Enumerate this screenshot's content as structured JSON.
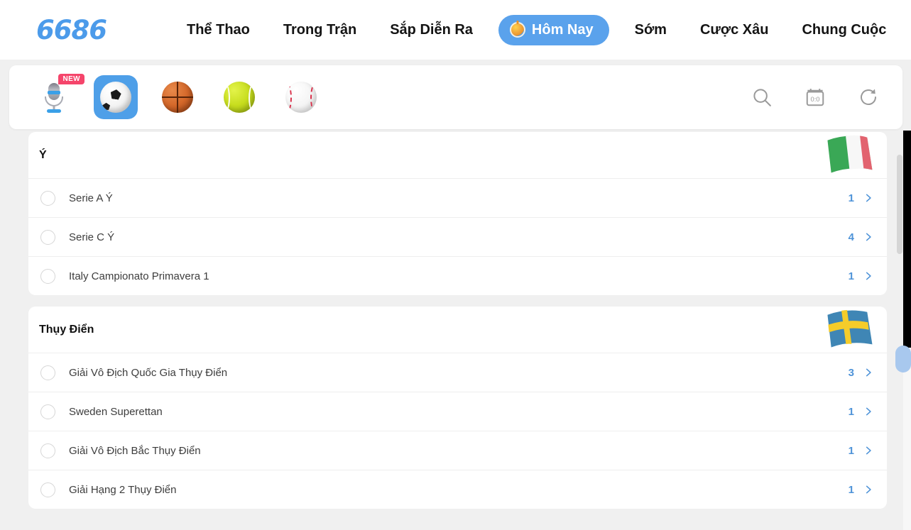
{
  "brand": {
    "logo_text": "6686",
    "logo_color": "#4c9bea"
  },
  "topnav": {
    "items": [
      {
        "label": "Thể Thao",
        "active": false
      },
      {
        "label": "Trong Trận",
        "active": false
      },
      {
        "label": "Sắp Diễn Ra",
        "active": false
      },
      {
        "label": "Hôm Nay",
        "active": true,
        "icon": "compass-icon"
      },
      {
        "label": "Sớm",
        "active": false
      },
      {
        "label": "Cược Xâu",
        "active": false
      },
      {
        "label": "Chung Cuộc",
        "active": false
      }
    ],
    "active_pill_color": "#5aa2ec"
  },
  "toolbar": {
    "sports": [
      {
        "name": "esports-mic",
        "icon": "microphone-icon",
        "badge": "NEW",
        "active": false
      },
      {
        "name": "football",
        "icon": "soccer-ball-icon",
        "badge": "",
        "active": true
      },
      {
        "name": "basketball",
        "icon": "basketball-icon",
        "badge": "",
        "active": false
      },
      {
        "name": "tennis",
        "icon": "tennis-ball-icon",
        "badge": "",
        "active": false
      },
      {
        "name": "baseball",
        "icon": "baseball-icon",
        "badge": "",
        "active": false
      }
    ],
    "actions": [
      {
        "name": "search",
        "icon": "search-icon"
      },
      {
        "name": "scoreboard",
        "icon": "scoreboard-icon",
        "value": "0:0"
      },
      {
        "name": "refresh",
        "icon": "refresh-icon"
      }
    ]
  },
  "main": {
    "sections": [
      {
        "country": "Ý",
        "flag": "italy-flag",
        "leagues": [
          {
            "name": "Serie A Ý",
            "count": "1"
          },
          {
            "name": "Serie C Ý",
            "count": "4"
          },
          {
            "name": "Italy Campionato Primavera 1",
            "count": "1"
          }
        ]
      },
      {
        "country": "Thụy Điển",
        "flag": "sweden-flag",
        "leagues": [
          {
            "name": "Giải Vô Địch Quốc Gia Thụy Điển",
            "count": "3"
          },
          {
            "name": "Sweden Superettan",
            "count": "1"
          },
          {
            "name": "Giải Vô Địch Bắc Thụy Điển",
            "count": "1"
          },
          {
            "name": "Giải Hạng 2 Thụy Điển",
            "count": "1"
          }
        ]
      }
    ]
  },
  "colors": {
    "accent": "#4e93d8",
    "brand": "#4c9bea",
    "badge": "#f5456b",
    "page_bg": "#f0f0f0"
  }
}
